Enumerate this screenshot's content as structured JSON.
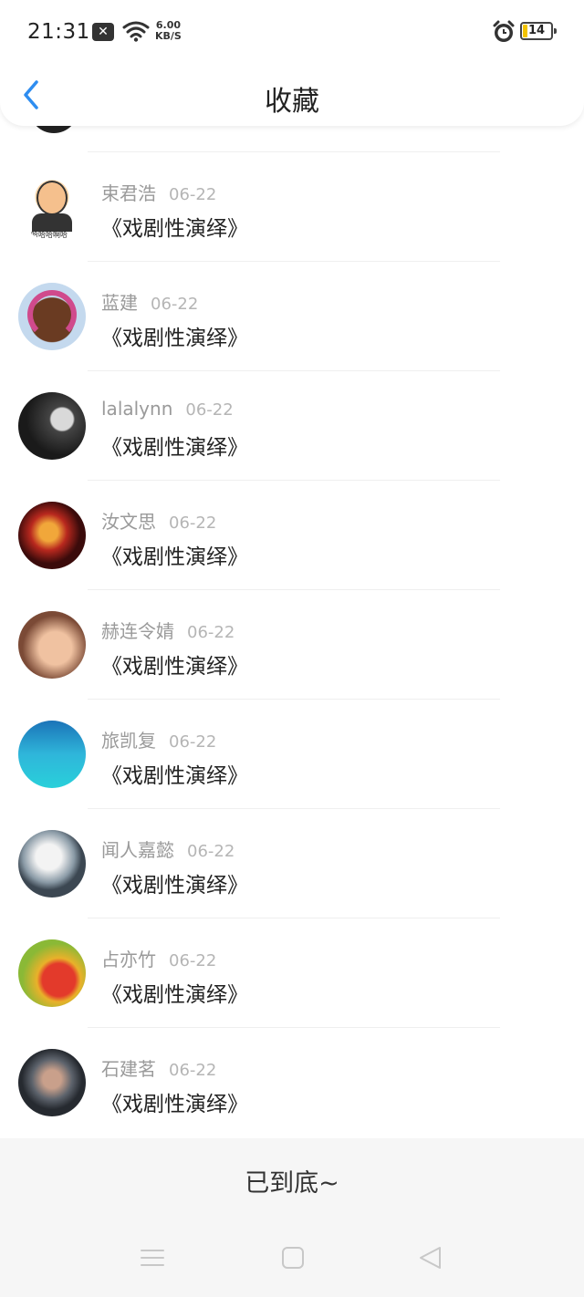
{
  "status_bar": {
    "time": "21:31",
    "speed_value": "6.00",
    "speed_unit": "KB/S",
    "battery": "14",
    "icons": [
      "close-notification-icon",
      "wifi-icon",
      "alarm-icon",
      "battery-icon"
    ]
  },
  "nav": {
    "title": "收藏",
    "back_icon": "chevron-left-icon",
    "back_color": "#2e8df0"
  },
  "items": [
    {
      "name": "束君浩",
      "date": "06-22",
      "work": "《戏剧性演绎》",
      "avatar_text": "哈哈哈啊哈"
    },
    {
      "name": "蓝建",
      "date": "06-22",
      "work": "《戏剧性演绎》"
    },
    {
      "name": "lalalynn",
      "date": "06-22",
      "work": "《戏剧性演绎》"
    },
    {
      "name": "汝文思",
      "date": "06-22",
      "work": "《戏剧性演绎》"
    },
    {
      "name": "赫连令婧",
      "date": "06-22",
      "work": "《戏剧性演绎》"
    },
    {
      "name": "旅凯复",
      "date": "06-22",
      "work": "《戏剧性演绎》"
    },
    {
      "name": "闻人嘉懿",
      "date": "06-22",
      "work": "《戏剧性演绎》"
    },
    {
      "name": "占亦竹",
      "date": "06-22",
      "work": "《戏剧性演绎》"
    },
    {
      "name": "石建茗",
      "date": "06-22",
      "work": "《戏剧性演绎》"
    }
  ],
  "footer": {
    "text": "已到底~"
  },
  "system_nav": {
    "buttons": [
      "menu-icon",
      "home-square-icon",
      "back-triangle-icon"
    ]
  }
}
